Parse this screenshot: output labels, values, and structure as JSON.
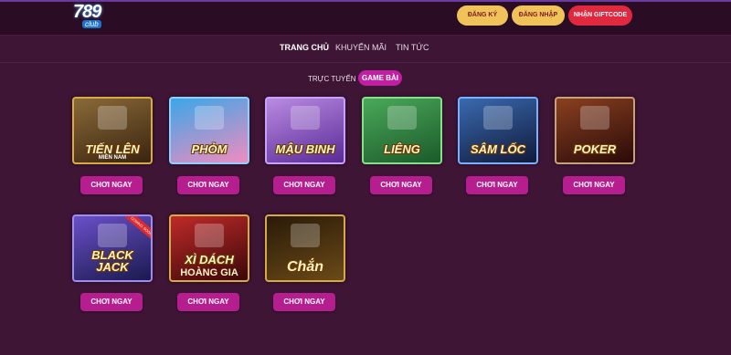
{
  "header": {
    "logo_text": "789",
    "logo_sub": "club",
    "signup_label": "ĐĂNG KÝ",
    "login_label": "ĐĂNG NHẬP",
    "giftcode_label": "NHẬN GIFTCODE"
  },
  "nav": {
    "items": [
      "TRANG CHỦ",
      "KHUYẾN MÃI",
      "TIN TỨC"
    ]
  },
  "filter": {
    "label": "TRỰC TUYẾN",
    "active_tab": "GAME BÀI"
  },
  "games": [
    {
      "title": "TIẾN LÊN",
      "subtitle": "MIỀN NAM",
      "play_label": "CHƠI NGAY"
    },
    {
      "title": "PHỎM",
      "subtitle": "",
      "play_label": "CHƠI NGAY"
    },
    {
      "title": "MẬU BINH",
      "subtitle": "",
      "play_label": "CHƠI NGAY"
    },
    {
      "title": "LIÊNG",
      "subtitle": "",
      "play_label": "CHƠI NGAY"
    },
    {
      "title": "SÂM LỐC",
      "subtitle": "",
      "play_label": "CHƠI NGAY"
    },
    {
      "title": "POKER",
      "subtitle": "",
      "play_label": "CHƠI NGAY"
    },
    {
      "title": "BLACK JACK",
      "subtitle": "",
      "badge": "COMING SOON",
      "play_label": "CHƠI NGAY"
    },
    {
      "title": "XÌ DÁCH",
      "subtitle": "HOÀNG GIA",
      "play_label": "CHƠI NGAY"
    },
    {
      "title": "Chắn",
      "subtitle": "",
      "play_label": "CHƠI NGAY"
    }
  ],
  "colors": {
    "background": "#3f1536",
    "accent": "#c01ea3",
    "button_gold": "#f0c35a",
    "button_red": "#e0283f"
  }
}
